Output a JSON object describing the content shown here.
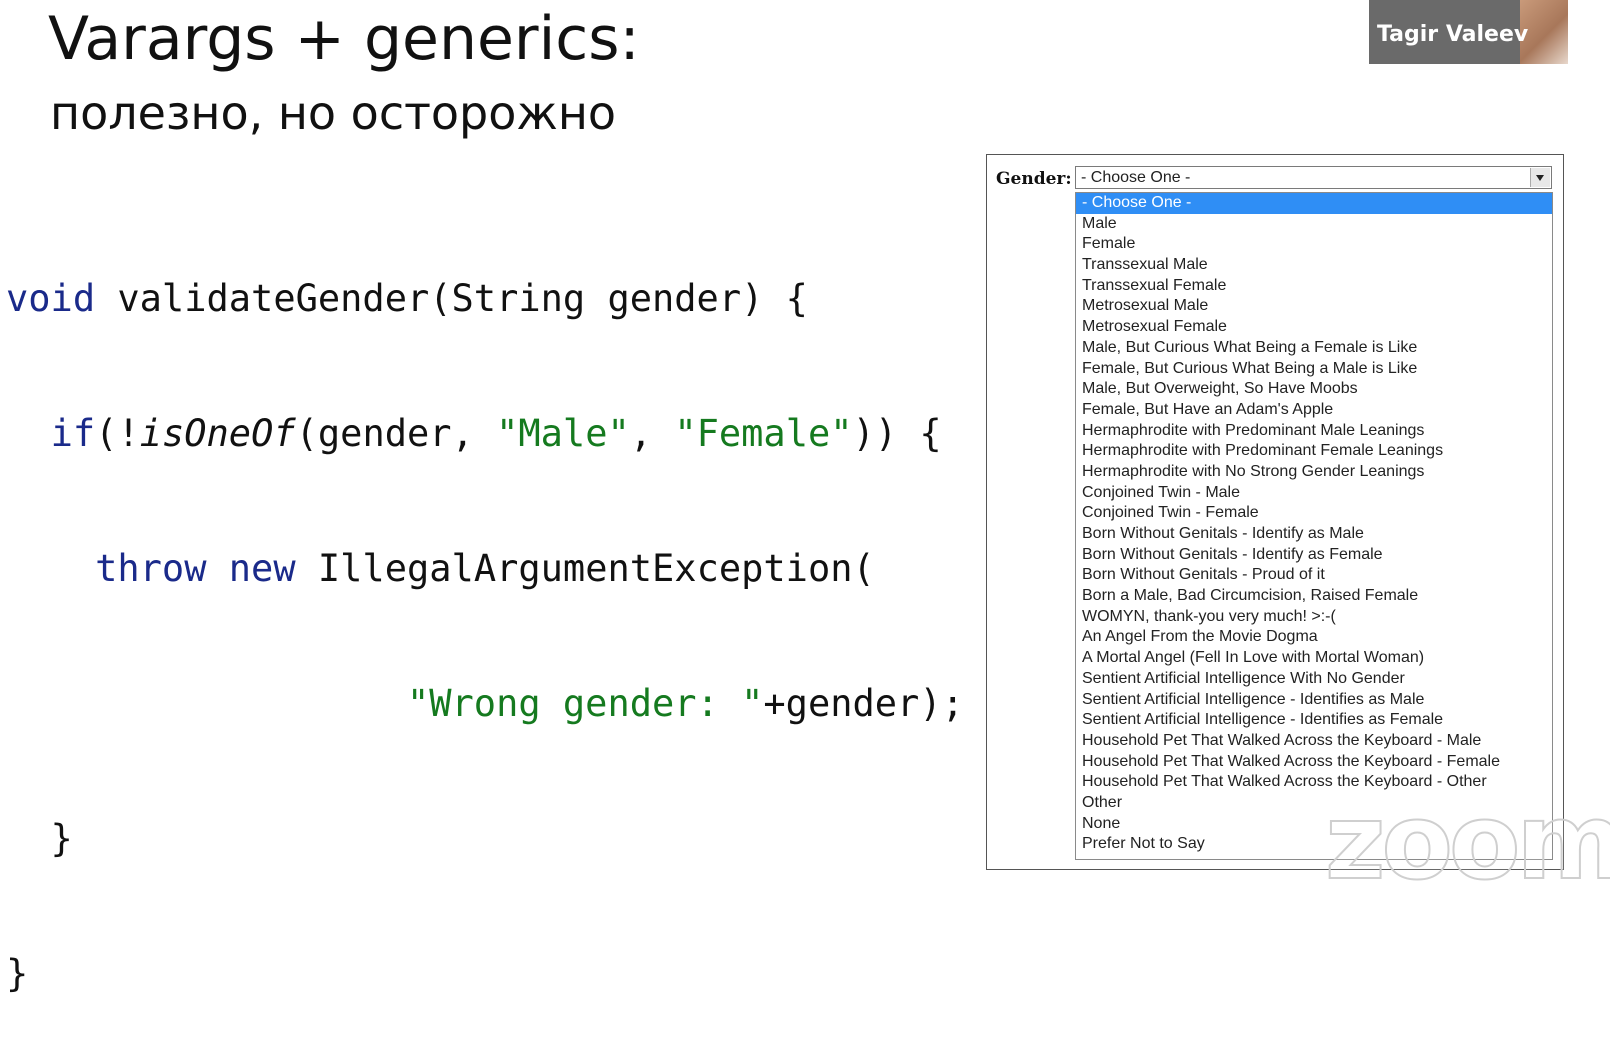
{
  "slide": {
    "title": "Varargs + generics:",
    "subtitle": "полезно, но осторожно"
  },
  "code": {
    "l1_kw": "void",
    "l1_rest": " validateGender(String gender) {",
    "l2_indent": "  ",
    "l2_kw": "if",
    "l2_a": "(!",
    "l2_method": "isOneOf",
    "l2_b": "(gender, ",
    "l2_s1": "\"Male\"",
    "l2_c": ", ",
    "l2_s2": "\"Female\"",
    "l2_d": ")) {",
    "l3_indent": "    ",
    "l3_kw1": "throw",
    "l3_sp": " ",
    "l3_kw2": "new",
    "l3_rest": " IllegalArgumentException(",
    "l4_indent": "                  ",
    "l4_str": "\"Wrong gender: \"",
    "l4_rest": "+gender);",
    "l5": "  }",
    "l6": "}"
  },
  "video": {
    "participant_name": "Tagir Valeev"
  },
  "form": {
    "label": "Gender:",
    "selected": "- Choose One -",
    "options": [
      "- Choose One -",
      "Male",
      "Female",
      "Transsexual Male",
      "Transsexual Female",
      "Metrosexual Male",
      "Metrosexual Female",
      "Male, But Curious What Being a Female is Like",
      "Female, But Curious What Being a Male is Like",
      "Male, But Overweight, So Have Moobs",
      "Female, But Have an Adam's Apple",
      "Hermaphrodite with Predominant Male Leanings",
      "Hermaphrodite with Predominant Female Leanings",
      "Hermaphrodite with No Strong Gender Leanings",
      "Conjoined Twin - Male",
      "Conjoined Twin - Female",
      "Born Without Genitals - Identify as Male",
      "Born Without Genitals - Identify as Female",
      "Born Without Genitals - Proud of it",
      "Born a Male, Bad Circumcision, Raised Female",
      "WOMYN, thank-you very much! >:-(",
      "An Angel From the Movie Dogma",
      "A Mortal Angel (Fell In Love with Mortal Woman)",
      "Sentient Artificial Intelligence With No Gender",
      "Sentient Artificial Intelligence - Identifies as Male",
      "Sentient Artificial Intelligence - Identifies as Female",
      "Household Pet That Walked Across the Keyboard - Male",
      "Household Pet That Walked Across the Keyboard - Female",
      "Household Pet That Walked Across the Keyboard - Other",
      "Other",
      "None",
      "Prefer Not to Say"
    ]
  },
  "watermark": "zoom"
}
